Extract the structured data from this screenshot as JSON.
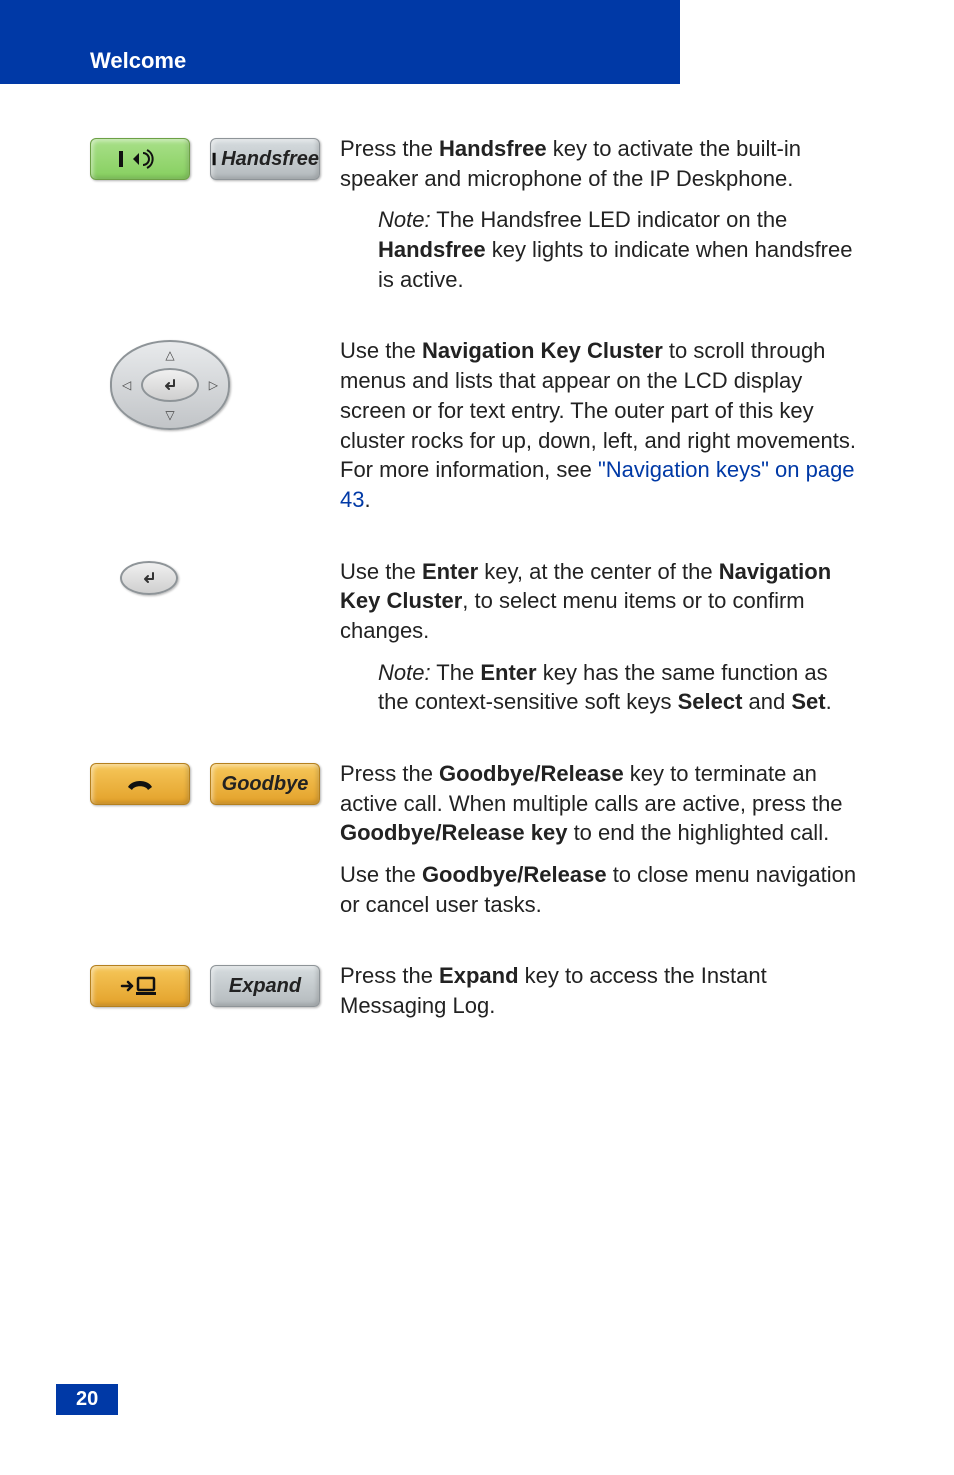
{
  "header": {
    "title": "Welcome"
  },
  "rows": {
    "handsfree": {
      "softkey_label": "Handsfree",
      "para1_pre": "Press the ",
      "para1_key": "Handsfree",
      "para1_post": " key to activate the built-in speaker and microphone of the IP Deskphone.",
      "note_label": "Note:",
      "note_pre": " The Handsfree LED indicator on the ",
      "note_key": "Handsfree",
      "note_post": " key lights to indicate when handsfree is active."
    },
    "nav": {
      "para_pre": "Use the ",
      "para_key": "Navigation Key Cluster",
      "para_mid": " to scroll through menus and lists that appear on the LCD display screen or for text entry. The outer part of this key cluster rocks for up, down, left, and right movements. For more information, see ",
      "para_link": "\"Navigation keys\" on page 43",
      "para_post": "."
    },
    "enter": {
      "para1_pre": "Use the ",
      "para1_key": "Enter",
      "para1_mid": " key, at the center of the ",
      "para1_key2": "Navigation Key Cluster",
      "para1_post": ", to select menu items or to confirm changes.",
      "note_label": "Note:",
      "note_pre": " The ",
      "note_key": "Enter",
      "note_mid": " key has the same function as the context-sensitive soft keys ",
      "note_key2": "Select",
      "note_and": " and ",
      "note_key3": "Set",
      "note_post": "."
    },
    "goodbye": {
      "softkey_label": "Goodbye",
      "para1_pre": "Press the ",
      "para1_key": "Goodbye/Release",
      "para1_mid": " key to terminate an active call. When multiple calls are active, press the ",
      "para1_key2": "Goodbye/Release key",
      "para1_post": " to end the highlighted call.",
      "para2_pre": "Use the ",
      "para2_key": "Goodbye/Release",
      "para2_post": " to close menu navigation or cancel user tasks."
    },
    "expand": {
      "softkey_label": "Expand",
      "para_pre": "Press the ",
      "para_key": "Expand",
      "para_post": " key to access the Instant Messaging Log."
    }
  },
  "footer": {
    "page_number": "20"
  }
}
